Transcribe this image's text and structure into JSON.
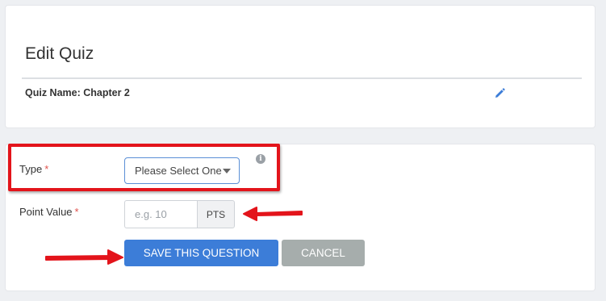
{
  "header": {
    "title": "Edit Quiz",
    "quiz_name": "Quiz Name: Chapter 2"
  },
  "form": {
    "type": {
      "label": "Type",
      "required_mark": "*",
      "selected": "Please Select One"
    },
    "point_value": {
      "label": "Point Value",
      "required_mark": "*",
      "placeholder": "e.g. 10",
      "value": "",
      "unit": "PTS"
    },
    "info_icon": "i",
    "save_label": "SAVE THIS QUESTION",
    "cancel_label": "CANCEL"
  },
  "colors": {
    "accent": "#3c7dd8",
    "cancel": "#a6adac",
    "required": "#e0524d",
    "annotation": "#e3141b"
  },
  "icons": {
    "edit": "pencil-icon",
    "info": "info-icon",
    "select": "caret-down-icon"
  }
}
